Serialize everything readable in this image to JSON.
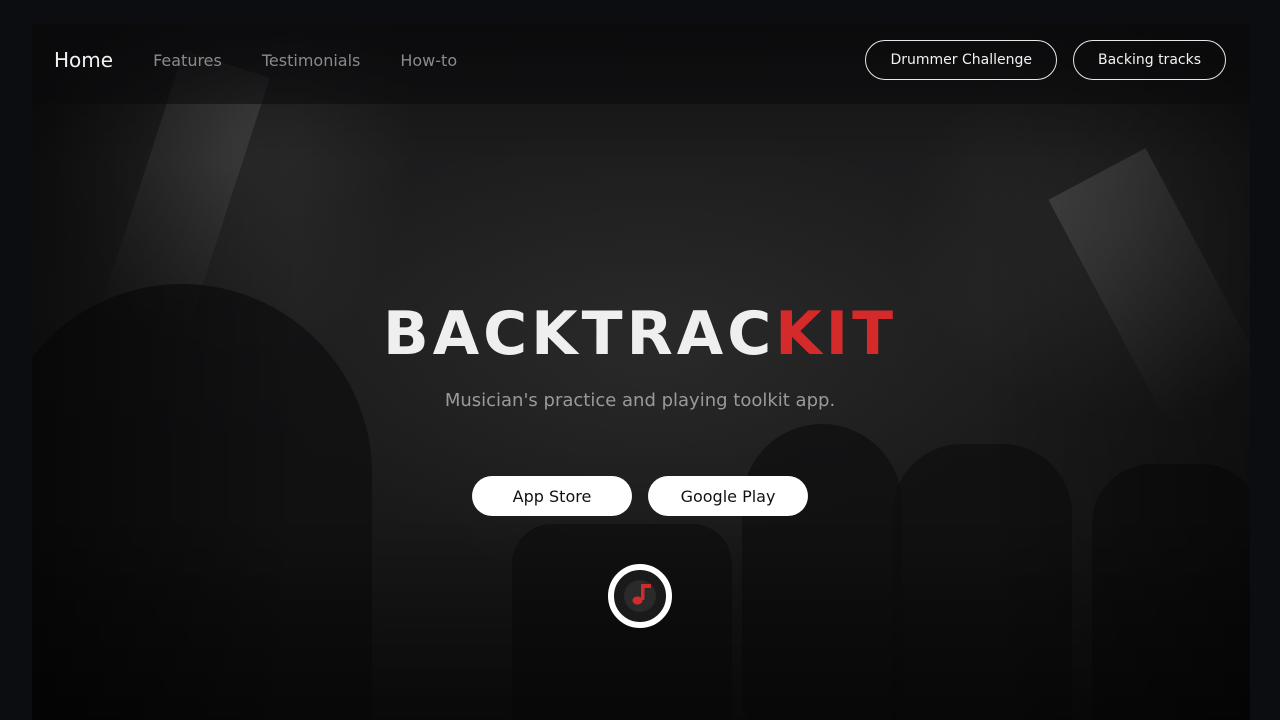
{
  "nav": {
    "home": "Home",
    "features": "Features",
    "testimonials": "Testimonials",
    "howto": "How-to",
    "drummer_challenge": "Drummer Challenge",
    "backing_tracks": "Backing tracks"
  },
  "hero": {
    "brand_part_a": "BACKTRAC",
    "brand_part_b": "KIT",
    "tagline": "Musician's practice and playing toolkit app.",
    "app_store": "App Store",
    "google_play": "Google Play",
    "logo_icon": "music-note-icon"
  },
  "colors": {
    "accent": "#d42a2a",
    "background": "#0c0d10",
    "text_primary": "#efefef",
    "text_muted": "#9a9a9e"
  }
}
